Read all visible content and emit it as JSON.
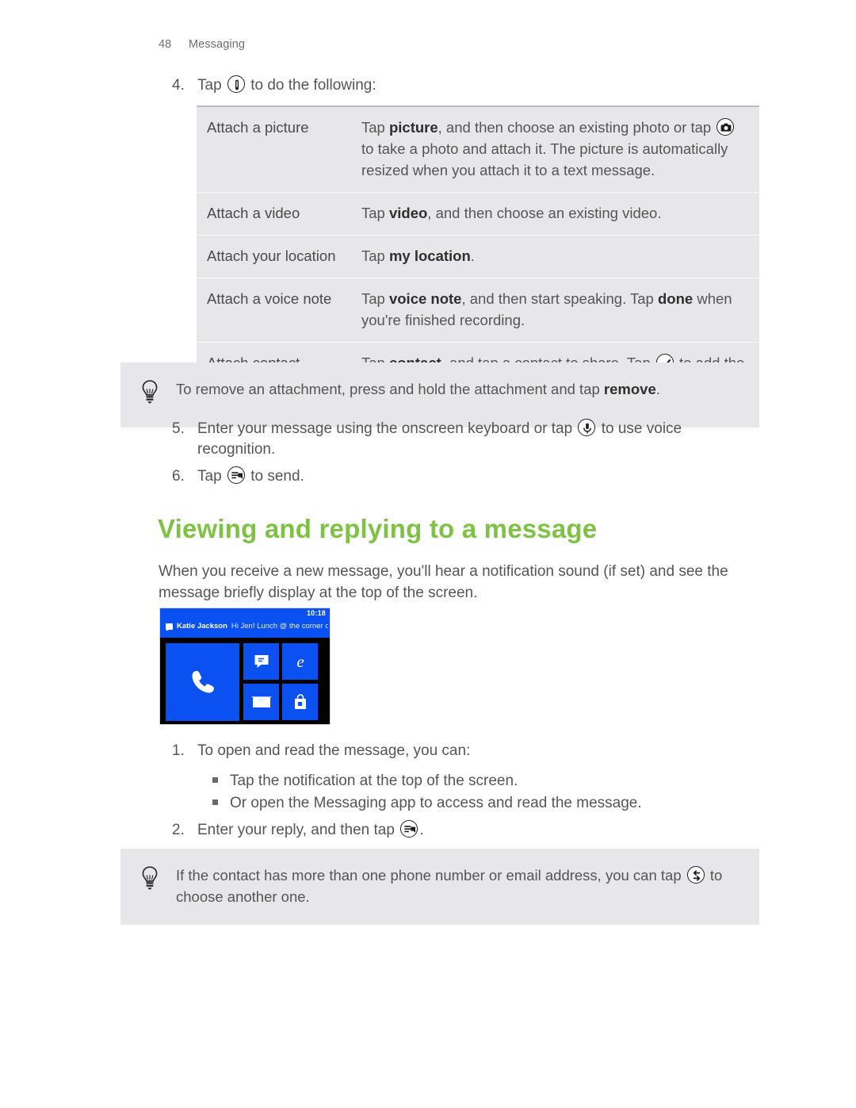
{
  "header": {
    "page_number": "48",
    "section": "Messaging"
  },
  "steps": {
    "step4": {
      "num": "4.",
      "text_before": "Tap",
      "icon": "paperclip-icon",
      "text_after": "to do the following:"
    },
    "step5": {
      "num": "5.",
      "text_before": "Enter your message using the onscreen keyboard or tap",
      "icon": "microphone-icon",
      "text_after": "to use voice recognition."
    },
    "step6": {
      "num": "6.",
      "text_before": "Tap",
      "icon": "send-icon",
      "text_after": "to send."
    }
  },
  "attachment_table": {
    "rows": [
      {
        "label": "Attach a picture",
        "segments": [
          {
            "type": "text",
            "value": "Tap "
          },
          {
            "type": "bold",
            "value": "picture"
          },
          {
            "type": "text",
            "value": ", and then choose an existing photo or tap "
          },
          {
            "type": "icon",
            "value": "camera-icon"
          },
          {
            "type": "text",
            "value": " to take a photo and attach it. The picture is automatically resized when you attach it to a text message."
          }
        ]
      },
      {
        "label": "Attach a video",
        "segments": [
          {
            "type": "text",
            "value": "Tap "
          },
          {
            "type": "bold",
            "value": "video"
          },
          {
            "type": "text",
            "value": ", and then choose an existing video."
          }
        ]
      },
      {
        "label": "Attach your location",
        "segments": [
          {
            "type": "text",
            "value": "Tap "
          },
          {
            "type": "bold",
            "value": "my location"
          },
          {
            "type": "text",
            "value": "."
          }
        ]
      },
      {
        "label": "Attach a voice note",
        "segments": [
          {
            "type": "text",
            "value": "Tap "
          },
          {
            "type": "bold",
            "value": "voice note"
          },
          {
            "type": "text",
            "value": ", and then start speaking. Tap "
          },
          {
            "type": "bold",
            "value": "done"
          },
          {
            "type": "text",
            "value": " when you're finished recording."
          }
        ]
      },
      {
        "label": "Attach contact information",
        "segments": [
          {
            "type": "text",
            "value": "Tap "
          },
          {
            "type": "bold",
            "value": "contact"
          },
          {
            "type": "text",
            "value": ", and tap a contact to share. Tap "
          },
          {
            "type": "icon",
            "value": "check-icon"
          },
          {
            "type": "text",
            "value": " to add the contact to your message."
          }
        ]
      }
    ]
  },
  "tip_top": {
    "icon": "lightbulb-icon",
    "segments": [
      {
        "type": "text",
        "value": "To remove an attachment, press and hold the attachment and tap "
      },
      {
        "type": "bold",
        "value": "remove"
      },
      {
        "type": "text",
        "value": "."
      }
    ]
  },
  "heading": {
    "text": "Viewing and replying to a message",
    "color": "#7dc242"
  },
  "intro_paragraph": "When you receive a new message, you'll hear a notification sound (if set) and see the message briefly display at the top of the screen.",
  "phone_screenshot": {
    "clock": "10:18",
    "notification_sender": "Katie Jackson",
    "notification_message": "Hi Jen! Lunch @ the corner café",
    "accent_color": "#0b50f0",
    "tiles": [
      {
        "name": "phone-tile",
        "icon": "phone-handset-icon"
      },
      {
        "name": "messaging-tile",
        "icon": "messaging-icon"
      },
      {
        "name": "internet-explorer-tile",
        "icon": "internet-explorer-icon"
      },
      {
        "name": "mail-tile",
        "icon": "envelope-icon"
      },
      {
        "name": "store-tile",
        "icon": "store-bag-icon"
      }
    ]
  },
  "reply_steps": {
    "step1": {
      "num": "1.",
      "text": "To open and read the message, you can:"
    },
    "bullets": [
      "Tap the notification at the top of the screen.",
      "Or open the Messaging app to access and read the message."
    ],
    "step2": {
      "num": "2.",
      "text_before": "Enter your reply, and then tap",
      "icon": "send-icon",
      "text_after": "."
    }
  },
  "tip_bottom": {
    "icon": "lightbulb-icon",
    "segments": [
      {
        "type": "text",
        "value": "If the contact has more than one phone number or email address, you can tap "
      },
      {
        "type": "icon",
        "value": "swap-icon"
      },
      {
        "type": "text",
        "value": " to choose another one."
      }
    ]
  }
}
